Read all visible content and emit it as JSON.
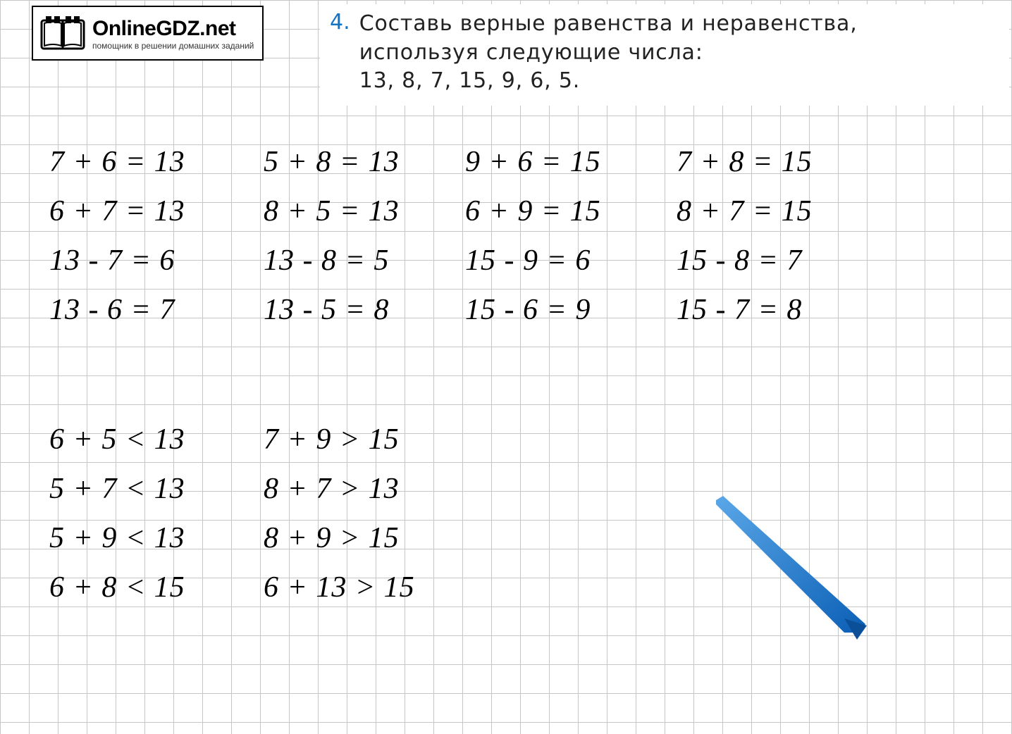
{
  "logo": {
    "title": "OnlineGDZ.net",
    "subtitle": "помощник в решении домашних заданий",
    "icon_name": "open-book-icon"
  },
  "task": {
    "number": "4.",
    "line1": "Составь верные равенства и неравенства,",
    "line2": "используя следующие числа:",
    "line3": "13, 8, 7, 15, 9, 6, 5."
  },
  "equalities": {
    "col1": [
      "7 + 6 = 13",
      "6 + 7 = 13",
      "13 - 7 = 6",
      "13 - 6 = 7"
    ],
    "col2": [
      "5 + 8 = 13",
      "8 + 5 = 13",
      "13 - 8 = 5",
      "13 - 5 = 8"
    ],
    "col3": [
      "9 + 6 = 15",
      "6 + 9 = 15",
      "15 - 9 = 6",
      "15 - 6 = 9"
    ],
    "col4": [
      "7 + 8 = 15",
      "8 + 7 = 15",
      "15 - 8 = 7",
      "15 - 7 = 8"
    ]
  },
  "inequalities": {
    "col1": [
      "6 + 5 < 13",
      "5 + 7 < 13",
      "5 + 9 < 13",
      "6 + 8 < 15"
    ],
    "col2": [
      "7 + 9 > 15",
      "8 + 7 > 13",
      "8 + 9 > 15",
      "6 + 13 > 15"
    ]
  },
  "decoration": {
    "pen_name": "blue-pen-icon"
  }
}
